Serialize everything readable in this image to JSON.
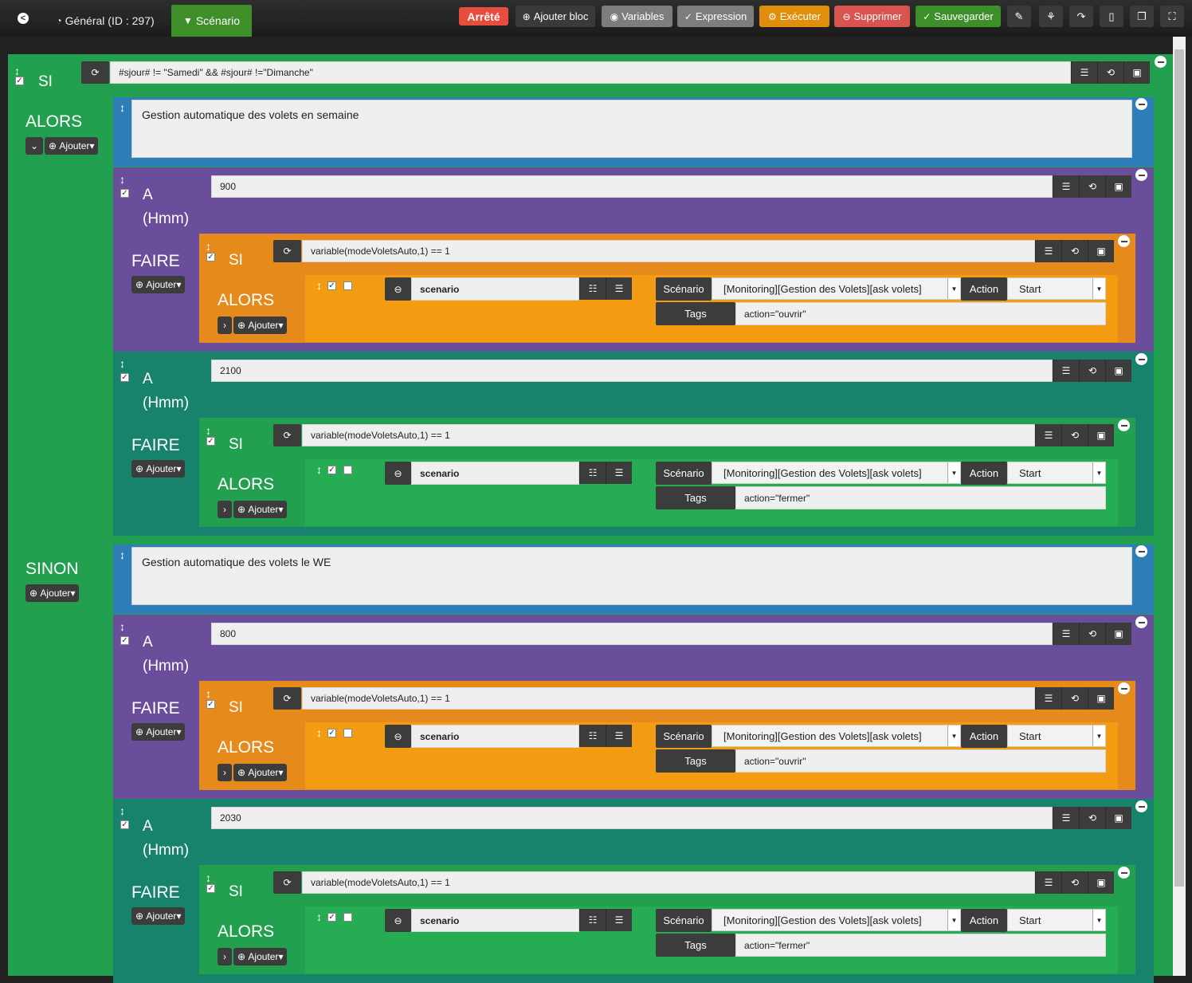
{
  "topbar": {
    "general_label": "Général (ID : 297)",
    "scenario_tab": "Scénario",
    "status": "Arrêté",
    "add_block": "Ajouter bloc",
    "variables": "Variables",
    "expression": "Expression",
    "execute": "Exécuter",
    "delete": "Supprimer",
    "save": "Sauvegarder"
  },
  "root": {
    "si_label": "SI",
    "condition": "#sjour# != \"Samedi\" && #sjour# !=\"Dimanche\"",
    "alors_label": "ALORS",
    "sinon_label": "SINON",
    "add_label": "Ajouter"
  },
  "labels": {
    "a": "A",
    "hmm": "(Hmm)",
    "faire": "FAIRE",
    "si": "SI",
    "alors": "ALORS",
    "scenario_field": "scenario",
    "scenario_col": "Scénario",
    "scenario_value": "[Monitoring][Gestion des Volets][ask volets]",
    "action_col": "Action",
    "action_value": "Start",
    "tags_col": "Tags",
    "inner_condition": "variable(modeVoletsAuto,1) == 1",
    "add_label": "Ajouter"
  },
  "sections": [
    {
      "comment": "Gestion automatique des volets en semaine",
      "blocks": [
        {
          "time": "900",
          "tags": "action=\"ouvrir\""
        },
        {
          "time": "2100",
          "tags": "action=\"fermer\""
        }
      ]
    },
    {
      "comment": "Gestion automatique des volets le WE",
      "blocks": [
        {
          "time": "800",
          "tags": "action=\"ouvrir\""
        },
        {
          "time": "2030",
          "tags": "action=\"fermer\""
        }
      ]
    }
  ],
  "colors": {
    "green": "#23a04f",
    "blue": "#2d7db8",
    "purple": "#6a4e9b",
    "teal": "#17836c",
    "orange": "#e58a1b",
    "orange_inner": "#f39c12",
    "green_inner": "#26ad54",
    "red": "#e74c3c"
  }
}
